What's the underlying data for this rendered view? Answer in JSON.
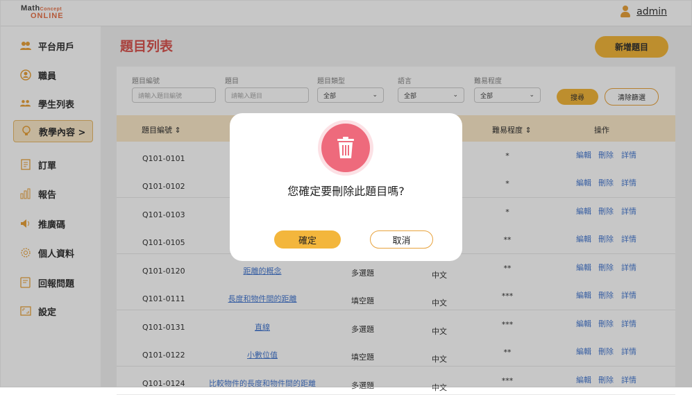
{
  "brand": {
    "line1_a": "Math",
    "line1_b": "Concept",
    "line2": "ONLINE"
  },
  "user": {
    "name": "admin",
    "icon": "user-icon"
  },
  "sidebar": {
    "items": [
      {
        "label": "平台用戶",
        "icon": "users-icon"
      },
      {
        "label": "職員",
        "icon": "staff-icon"
      },
      {
        "label": "學生列表",
        "icon": "students-icon"
      },
      {
        "label": "教學內容 >",
        "icon": "lightbulb-icon",
        "active": true
      },
      {
        "label": "訂單",
        "icon": "order-icon"
      },
      {
        "label": "報告",
        "icon": "report-icon"
      },
      {
        "label": "推廣碼",
        "icon": "megaphone-icon"
      },
      {
        "label": "個人資料",
        "icon": "profile-icon"
      },
      {
        "label": "回報問題",
        "icon": "feedback-icon"
      },
      {
        "label": "設定",
        "icon": "settings-icon"
      }
    ]
  },
  "page": {
    "title": "題目列表",
    "new_button": "新增題目"
  },
  "filters": {
    "id_label": "題目編號",
    "id_placeholder": "請輸入題目編號",
    "title_label": "題目",
    "title_placeholder": "請輸入題目",
    "type_label": "題目類型",
    "type_value": "全部",
    "lang_label": "語言",
    "lang_value": "全部",
    "diff_label": "難易程度",
    "diff_value": "全部",
    "search_button": "搜尋",
    "clear_button": "清除篩選"
  },
  "table": {
    "headers": {
      "id": "題目編號 ⇕",
      "difficulty": "難易程度 ⇕",
      "actions": "操作"
    },
    "actions": {
      "edit": "編輯",
      "delete": "刪除",
      "detail": "詳情"
    },
    "rows": [
      {
        "id": "Q101-0101",
        "title": "",
        "type": "",
        "lang": "",
        "difficulty": "*"
      },
      {
        "id": "Q101-0102",
        "title": "",
        "type": "",
        "lang": "",
        "difficulty": "*"
      },
      {
        "id": "Q101-0103",
        "title": "",
        "type": "",
        "lang": "",
        "difficulty": "*"
      },
      {
        "id": "Q101-0105",
        "title": "",
        "type": "",
        "lang": "",
        "difficulty": "**"
      },
      {
        "id": "Q101-0120",
        "title": "距離的概念",
        "type": "多選題",
        "lang": "中文",
        "difficulty": "**"
      },
      {
        "id": "Q101-0111",
        "title": "長度和物件間的距離",
        "type": "填空題",
        "lang": "中文",
        "difficulty": "***"
      },
      {
        "id": "Q101-0131",
        "title": "直線",
        "type": "多選題",
        "lang": "中文",
        "difficulty": "***"
      },
      {
        "id": "Q101-0122",
        "title": "小數位值",
        "type": "填空題",
        "lang": "中文",
        "difficulty": "**"
      },
      {
        "id": "Q101-0124",
        "title": "比較物件的長度和物件間的距離",
        "type": "多選題",
        "lang": "中文",
        "difficulty": "***"
      }
    ]
  },
  "dialog": {
    "icon": "trash-icon",
    "message": "您確定要刪除此題目嗎?",
    "ok": "確定",
    "cancel": "取消"
  }
}
